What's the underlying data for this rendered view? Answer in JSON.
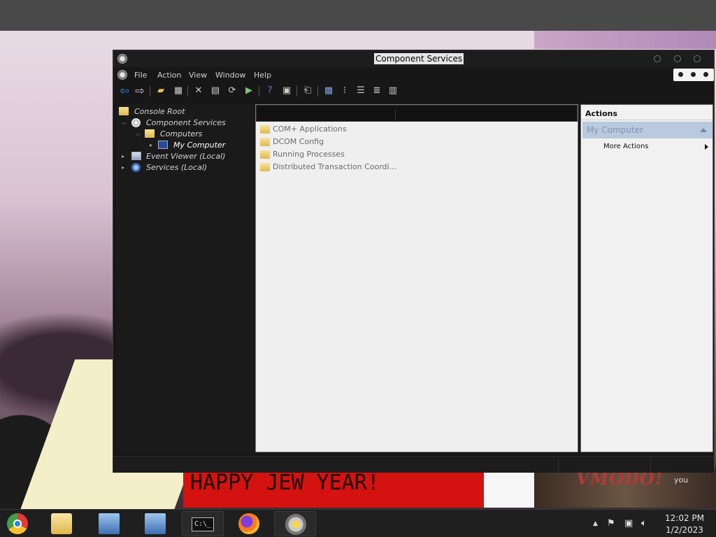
{
  "window": {
    "title": "Component Services"
  },
  "menu": [
    "File",
    "Action",
    "View",
    "Window",
    "Help"
  ],
  "tree": [
    {
      "label": "Console Root"
    },
    {
      "label": "Component Services"
    },
    {
      "label": "Computers"
    },
    {
      "label": "My Computer"
    },
    {
      "label": "Event Viewer (Local)"
    },
    {
      "label": "Services (Local)"
    }
  ],
  "list_items": [
    "COM+ Applications",
    "DCOM Config",
    "Running Processes",
    "Distributed Transaction Coordi..."
  ],
  "actions": {
    "header": "Actions",
    "section": "My Computer",
    "more": "More Actions"
  },
  "background": {
    "banner_text": "HAPPY JEW YEAR!",
    "video_logo": "VMODO!",
    "video_caption": "you"
  },
  "taskbar": {
    "time": "12:02 PM",
    "date": "1/2/2023",
    "cmd_label": "C:\\_"
  }
}
